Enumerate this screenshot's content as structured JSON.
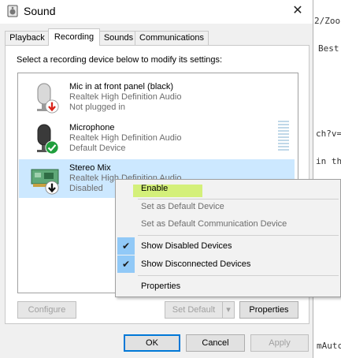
{
  "background": {
    "fragments": [
      "2/Zoo",
      "Best F",
      "ch?v=",
      "in th",
      "mAutc"
    ]
  },
  "window": {
    "title": "Sound",
    "close_label": "✕"
  },
  "tabs": [
    "Playback",
    "Recording",
    "Sounds",
    "Communications"
  ],
  "active_tab": "Recording",
  "instructions": "Select a recording device below to modify its settings:",
  "devices": [
    {
      "name": "Mic in at front panel (black)",
      "driver": "Realtek High Definition Audio",
      "status": "Not plugged in",
      "badge": "red-down-arrow-icon"
    },
    {
      "name": "Microphone",
      "driver": "Realtek High Definition Audio",
      "status": "Default Device",
      "badge": "green-check-icon"
    },
    {
      "name": "Stereo Mix",
      "driver": "Realtek High Definition Audio",
      "status": "Disabled",
      "badge": "black-down-arrow-icon"
    }
  ],
  "context_menu": {
    "items": [
      {
        "label": "Enable",
        "disabled": false
      },
      {
        "label": "Set as Default Device",
        "disabled": true
      },
      {
        "label": "Set as Default Communication Device",
        "disabled": true
      },
      {
        "label": "Show Disabled Devices",
        "checked": true
      },
      {
        "label": "Show Disconnected Devices",
        "checked": true
      },
      {
        "label": "Properties",
        "disabled": false
      }
    ]
  },
  "buttons": {
    "configure": "Configure",
    "set_default": "Set Default",
    "properties": "Properties",
    "ok": "OK",
    "cancel": "Cancel",
    "apply": "Apply"
  },
  "colors": {
    "selection": "#cce8ff",
    "menu_hover": "#91c9f7",
    "highlight_marker": "#d4f07a",
    "accent": "#0078d7"
  }
}
